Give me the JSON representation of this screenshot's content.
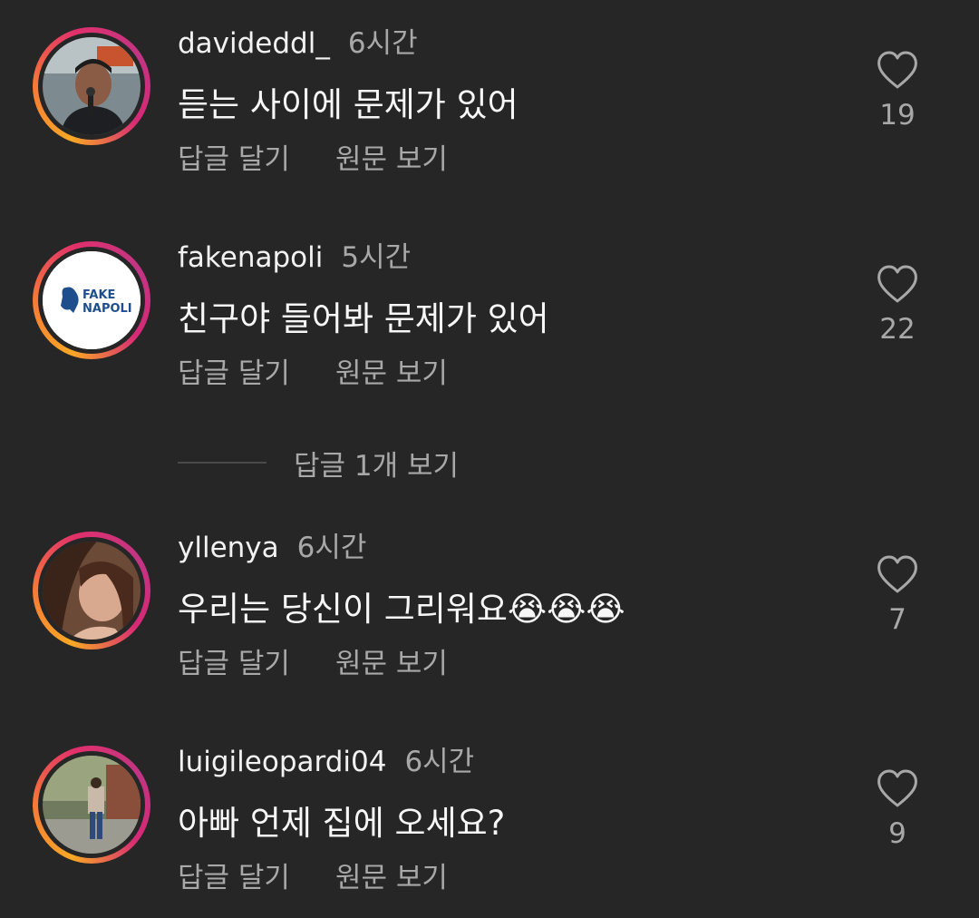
{
  "comments": [
    {
      "username": "davideddl_",
      "time": "6시간",
      "text": "듣는 사이에 문제가 있어",
      "reply_label": "답글 달기",
      "translate_label": "원문 보기",
      "likes": "19"
    },
    {
      "username": "fakenapoli",
      "time": "5시간",
      "text": "친구야 들어봐 문제가 있어",
      "reply_label": "답글 달기",
      "translate_label": "원문 보기",
      "likes": "22",
      "avatar_logo": [
        "FAKE",
        "NAPOLI"
      ]
    },
    {
      "username": "yllenya",
      "time": "6시간",
      "text": "우리는 당신이 그리워요😭😭😭",
      "reply_label": "답글 달기",
      "translate_label": "원문 보기",
      "likes": "7"
    },
    {
      "username": "luigileopardi04",
      "time": "6시간",
      "text": "아빠 언제 집에 오세요?",
      "reply_label": "답글 달기",
      "translate_label": "원문 보기",
      "likes": "9"
    }
  ],
  "view_replies": "답글 1개 보기",
  "icons": {
    "like": "heart-outline-icon"
  },
  "colors": {
    "background": "#262626",
    "primary_text": "#f5f5f5",
    "secondary_text": "#a8a8a8",
    "ring_gradient": [
      "#f9a825",
      "#e1306c",
      "#c13584"
    ]
  }
}
